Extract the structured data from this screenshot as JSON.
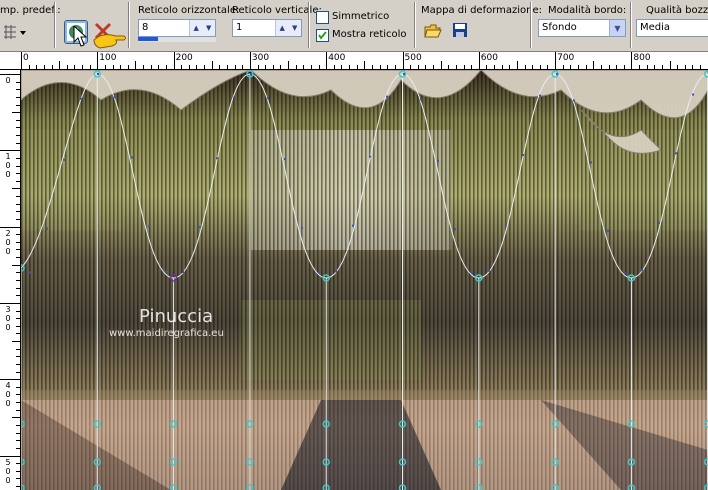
{
  "toolbar": {
    "preset_label": "mp. predef.:",
    "apply_label": "✓",
    "horizontal_grid": {
      "label": "Reticolo orizzontale:",
      "value": "8",
      "slider_fraction": 0.25
    },
    "vertical_grid": {
      "label": "Reticolo verticale:",
      "value": "1"
    },
    "symmetric": {
      "label": "Simmetrico",
      "checked": false
    },
    "show_grid": {
      "label": "Mostra reticolo",
      "checked": true
    },
    "displacement_map": {
      "label": "Mappa di deformazione:"
    },
    "edge_mode": {
      "label": "Modalità bordo:",
      "value": "Sfondo"
    },
    "draft_quality": {
      "label": "Qualità bozza:",
      "value": "Media"
    }
  },
  "ruler": {
    "top_labels": [
      "0",
      "100",
      "200",
      "300",
      "400",
      "500",
      "600",
      "700",
      "800"
    ],
    "left_labels": [
      [
        "0"
      ],
      [
        "1",
        "0",
        "0"
      ],
      [
        "2",
        "0",
        "0"
      ],
      [
        "3",
        "0",
        "0"
      ],
      [
        "4",
        "0",
        "0"
      ],
      [
        "5",
        "0",
        "0"
      ]
    ]
  },
  "watermark": {
    "title": "Pinuccia",
    "url": "www.maidiregrafica.eu"
  },
  "colors": {
    "grid_line": "#e8f0f0",
    "node": "#40c8c8",
    "node_selected": "#7030a0",
    "accent_bar": "#2457d6"
  }
}
